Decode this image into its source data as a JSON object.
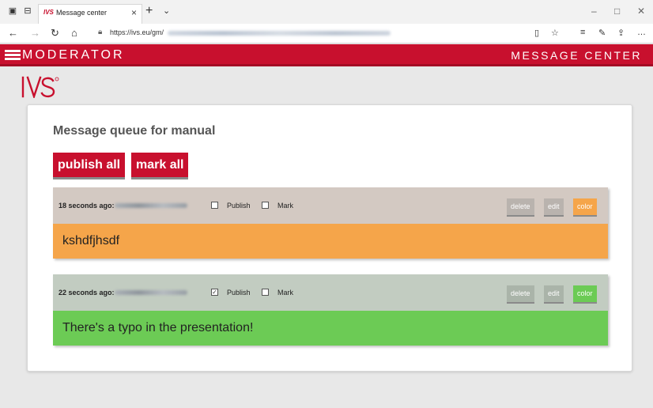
{
  "browser": {
    "tab_title": "Message center",
    "tab_favicon": "IVS",
    "url_visible": "https://ivs.eu/gm/"
  },
  "app": {
    "brand": "MODERATOR",
    "section": "MESSAGE CENTER",
    "logo_text": "IVS",
    "accent_color": "#c8102e"
  },
  "queue": {
    "title": "Message queue for manual",
    "publish_all_label": "publish all",
    "mark_all_label": "mark all"
  },
  "messages": [
    {
      "time": "18 seconds ago:",
      "publish_label": "Publish",
      "publish_checked": false,
      "mark_label": "Mark",
      "mark_checked": false,
      "delete_label": "delete",
      "edit_label": "edit",
      "color_label": "color",
      "text": "kshdfjhsdf",
      "head_color": "#d3c9c2",
      "body_color": "#f5a54a",
      "color_btn_color": "#f5a54a"
    },
    {
      "time": "22 seconds ago:",
      "publish_label": "Publish",
      "publish_checked": true,
      "mark_label": "Mark",
      "mark_checked": false,
      "delete_label": "delete",
      "edit_label": "edit",
      "color_label": "color",
      "text": "There's a typo in the presentation!",
      "head_color": "#c2ccc1",
      "body_color": "#6ccb55",
      "color_btn_color": "#6ccb55"
    }
  ]
}
